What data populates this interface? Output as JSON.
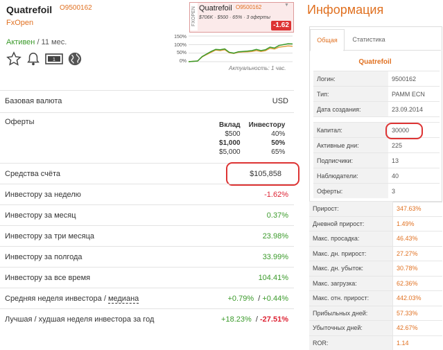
{
  "header": {
    "title": "Quatrefoil",
    "account_id": "O9500162",
    "broker": "FxOpen",
    "status_active": "Активен",
    "status_age": "/ 11 мес."
  },
  "icons": [
    "star-icon",
    "bell-icon",
    "money-icon",
    "globe-icon"
  ],
  "mini_widget": {
    "side_label": "FXOPEN",
    "name": "Quatrefoil",
    "id": "O9500162",
    "subline": "$706K · $500 · 65% · 3 оферты",
    "change": "-1.62"
  },
  "perf_chart": {
    "y_ticks": [
      "150%",
      "100%",
      "50%",
      "0%"
    ],
    "caption": "Актуальность: 1 час."
  },
  "chart_data": {
    "type": "line",
    "x": [
      0,
      1,
      2,
      3,
      4,
      5,
      6,
      7,
      8,
      9,
      10,
      11,
      12,
      13,
      14,
      15,
      16,
      17,
      18,
      19,
      20,
      21,
      22,
      23
    ],
    "ylim": [
      0,
      150
    ],
    "series": [
      {
        "color": "#3a9a2a",
        "values": [
          0,
          2,
          4,
          30,
          45,
          60,
          72,
          70,
          75,
          55,
          50,
          58,
          60,
          62,
          65,
          72,
          65,
          70,
          85,
          80,
          95,
          100,
          105,
          104
        ]
      },
      {
        "color": "#e0a040",
        "values": [
          0,
          2,
          4,
          28,
          42,
          55,
          68,
          65,
          70,
          52,
          48,
          55,
          57,
          58,
          60,
          65,
          60,
          64,
          78,
          74,
          85,
          88,
          92,
          90
        ]
      }
    ]
  },
  "table": {
    "base_currency_label": "Базовая валюта",
    "base_currency_value": "USD",
    "offers_label": "Оферты",
    "offers_head": [
      "Вклад",
      "Инвестору"
    ],
    "offers_rows": [
      [
        "$500",
        "40%"
      ],
      [
        "$1,000",
        "50%"
      ],
      [
        "$5,000",
        "65%"
      ]
    ],
    "equity_label": "Средства счёта",
    "equity_value": "$105,858",
    "week_label": "Инвестору за неделю",
    "week_value": "-1.62%",
    "month_label": "Инвестору за месяц",
    "month_value": "0.37%",
    "three_month_label": "Инвестору за три месяца",
    "three_month_value": "23.98%",
    "half_year_label": "Инвестору за полгода",
    "half_year_value": "33.99%",
    "all_time_label": "Инвестору за все время",
    "all_time_value": "104.41%",
    "avg_week_label": "Средняя неделя инвестора / ",
    "avg_week_median": "медиана",
    "avg_week_value": "+0.79%",
    "avg_week_sep": "/",
    "avg_week_median_value": "+0.44%",
    "best_worst_label": "Лучшая / худшая неделя инвестора за год",
    "best_value": "+18.23%",
    "best_sep": "/",
    "worst_value": "-27.51%"
  },
  "info": {
    "title": "Информация",
    "tab_general": "Общая",
    "tab_stats": "Статистика",
    "name": "Quatrefoil",
    "rows1": [
      [
        "Логин:",
        "9500162"
      ],
      [
        "Тип:",
        "PAMM ECN"
      ],
      [
        "Дата создания:",
        "23.09.2014"
      ]
    ],
    "rows1b": [
      [
        "Капитал:",
        "30000"
      ],
      [
        "Активные дни:",
        "225"
      ],
      [
        "Подписчики:",
        "13"
      ],
      [
        "Наблюдатели:",
        "40"
      ],
      [
        "Оферты:",
        "3"
      ]
    ],
    "rows2": [
      [
        "Прирост:",
        "347.63%"
      ],
      [
        "Дневной прирост:",
        "1.49%"
      ],
      [
        "Макс. просадка:",
        "46.43%"
      ],
      [
        "Макс. дн. прирост:",
        "27.27%"
      ],
      [
        "Макс. дн. убыток:",
        "30.78%"
      ],
      [
        "Макс. загрузка:",
        "62.36%"
      ],
      [
        "Макс. отн. прирост:",
        "442.03%"
      ],
      [
        "Прибыльных дней:",
        "57.33%"
      ],
      [
        "Убыточных дней:",
        "42.67%"
      ],
      [
        "ROR:",
        "1.14"
      ]
    ]
  }
}
